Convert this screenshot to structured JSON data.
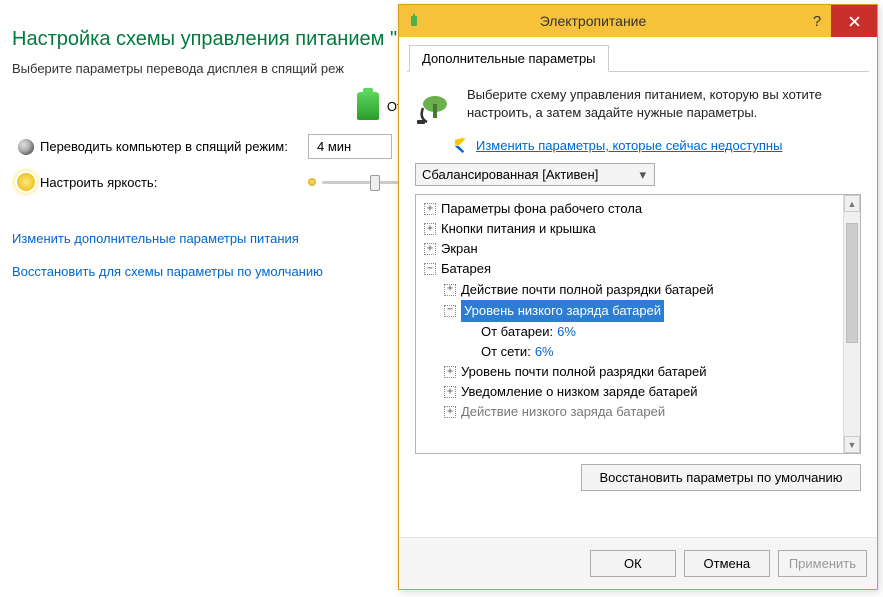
{
  "bg": {
    "title": "Настройка схемы управления питанием \"С",
    "subtitle": "Выберите параметры перевода дисплея в спящий реж",
    "battery_label_prefix": "От",
    "sleep_label": "Переводить компьютер в спящий режим:",
    "sleep_value": "4 мин",
    "brightness_label": "Настроить яркость:",
    "links": {
      "advanced": "Изменить дополнительные параметры питания",
      "restore": "Восстановить для схемы параметры по умолчанию"
    }
  },
  "dialog": {
    "title": "Электропитание",
    "tab": "Дополнительные параметры",
    "intro": "Выберите схему управления питанием, которую вы хотите настроить, а затем задайте нужные параметры.",
    "shield_link": "Изменить параметры, которые сейчас недоступны",
    "plan_selected": "Сбалансированная [Активен]",
    "restore_btn": "Восстановить параметры по умолчанию",
    "buttons": {
      "ok": "ОК",
      "cancel": "Отмена",
      "apply": "Применить"
    }
  },
  "tree": {
    "n0": "Параметры фона рабочего стола",
    "n1": "Кнопки питания и крышка",
    "n2": "Экран",
    "n3": "Батарея",
    "n3_0": "Действие почти полной разрядки батарей",
    "n3_1": "Уровень низкого заряда батарей",
    "n3_1_a_key": "От батареи:",
    "n3_1_a_val": "6%",
    "n3_1_b_key": "От сети:",
    "n3_1_b_val": "6%",
    "n3_2": "Уровень почти полной разрядки батарей",
    "n3_3": "Уведомление о низком заряде батарей",
    "n3_4": "Действие низкого заряда батарей"
  }
}
